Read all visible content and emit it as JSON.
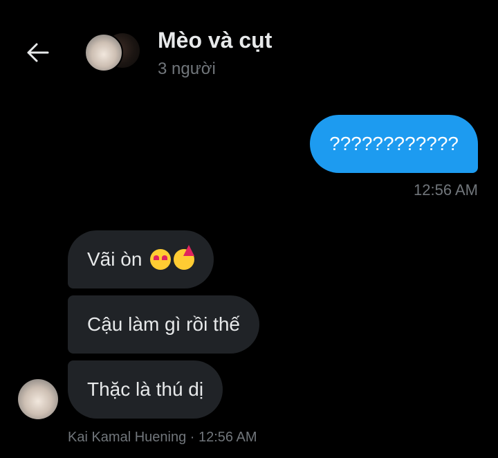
{
  "header": {
    "back_icon": "arrow-left-icon",
    "title": "Mèo và cụt",
    "subtitle": "3 người"
  },
  "messages": {
    "outgoing": {
      "text": "????????????",
      "time": "12:56 AM"
    },
    "incoming": [
      {
        "text": "Vãi òn",
        "emojis": [
          "heart-eyes-emoji",
          "party-face-emoji"
        ]
      },
      {
        "text": "Cậu làm gì rồi thế"
      },
      {
        "text": "Thặc là thú dị"
      }
    ],
    "incoming_meta": {
      "sender": "Kai Kamal Huening",
      "separator": " · ",
      "time": "12:56 AM"
    }
  },
  "colors": {
    "background": "#000000",
    "outgoing_bubble": "#1d9bf0",
    "incoming_bubble": "#202327",
    "muted_text": "#71767b",
    "primary_text": "#e7e9ea"
  }
}
